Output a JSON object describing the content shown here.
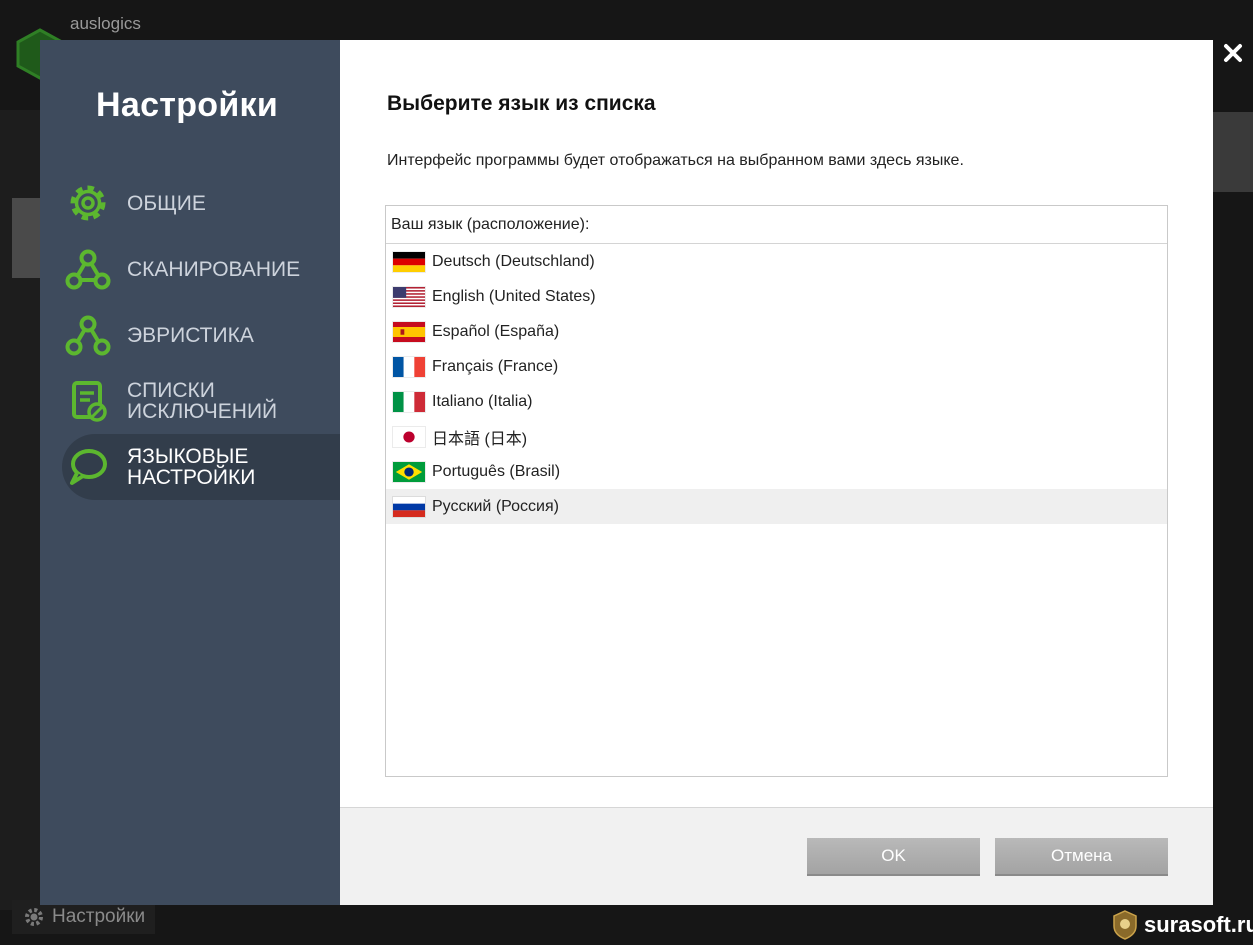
{
  "background_app": {
    "brand": "auslogics",
    "bottom_settings_label": "Настройки"
  },
  "watermark": "surasoft.ru",
  "sidebar": {
    "title": "Настройки",
    "items": [
      {
        "label": "ОБЩИЕ",
        "icon": "gear-icon",
        "active": false
      },
      {
        "label": "СКАНИРОВАНИЕ",
        "icon": "scan-nodes-icon",
        "active": false
      },
      {
        "label": "ЭВРИСТИКА",
        "icon": "heuristic-nodes-icon",
        "active": false
      },
      {
        "label": "СПИСКИ ИСКЛЮЧЕНИЙ",
        "icon": "exclusion-list-icon",
        "active": false
      },
      {
        "label": "ЯЗЫКОВЫЕ НАСТРОЙКИ",
        "icon": "speech-bubble-icon",
        "active": true
      }
    ]
  },
  "content": {
    "title": "Выберите язык из списка",
    "description": "Интерфейс программы будет отображаться на выбранном вами здесь языке.",
    "list_header": "Ваш язык (расположение):",
    "languages": [
      {
        "label": "Deutsch (Deutschland)",
        "flag": "flag-de"
      },
      {
        "label": "English (United States)",
        "flag": "flag-us"
      },
      {
        "label": "Español (España)",
        "flag": "flag-es"
      },
      {
        "label": "Français (France)",
        "flag": "flag-fr"
      },
      {
        "label": "Italiano (Italia)",
        "flag": "flag-it"
      },
      {
        "label": "日本語 (日本)",
        "flag": "flag-jp"
      },
      {
        "label": "Português (Brasil)",
        "flag": "flag-br"
      },
      {
        "label": "Русский (Россия)",
        "flag": "flag-ru"
      }
    ],
    "selected_language": "Русский (Россия)"
  },
  "footer": {
    "ok_label": "OK",
    "cancel_label": "Отмена"
  },
  "colors": {
    "sidebar_bg": "#3e4b5d",
    "sidebar_active_bg": "#323d4b",
    "accent_green": "#5cb72f",
    "button_gray": "#adadad"
  }
}
